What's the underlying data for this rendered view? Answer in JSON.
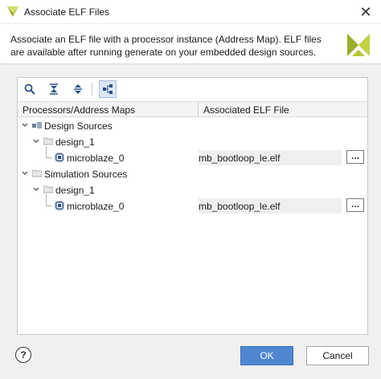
{
  "window": {
    "title": "Associate ELF Files",
    "close_glyph": "✕"
  },
  "header": {
    "description": "Associate an ELF file with a processor instance (Address Map). ELF files are available after running generate on your embedded design sources."
  },
  "toolbar": {
    "icons": [
      "search-icon",
      "collapse-all-icon",
      "expand-all-icon",
      "hierarchy-icon"
    ]
  },
  "table": {
    "columns": [
      "Processors/Address Maps",
      "Associated ELF File"
    ],
    "rows": [
      {
        "label": "Design Sources"
      },
      {
        "label": "design_1"
      },
      {
        "label": "microblaze_0",
        "elf": "mb_bootloop_le.elf"
      },
      {
        "label": "Simulation Sources"
      },
      {
        "label": "design_1"
      },
      {
        "label": "microblaze_0",
        "elf": "mb_bootloop_le.elf"
      }
    ],
    "browse_glyph": "..."
  },
  "footer": {
    "help_glyph": "?",
    "ok_label": "OK",
    "cancel_label": "Cancel"
  },
  "colors": {
    "accent": "#4f88d1",
    "logo": "#b5c832"
  }
}
